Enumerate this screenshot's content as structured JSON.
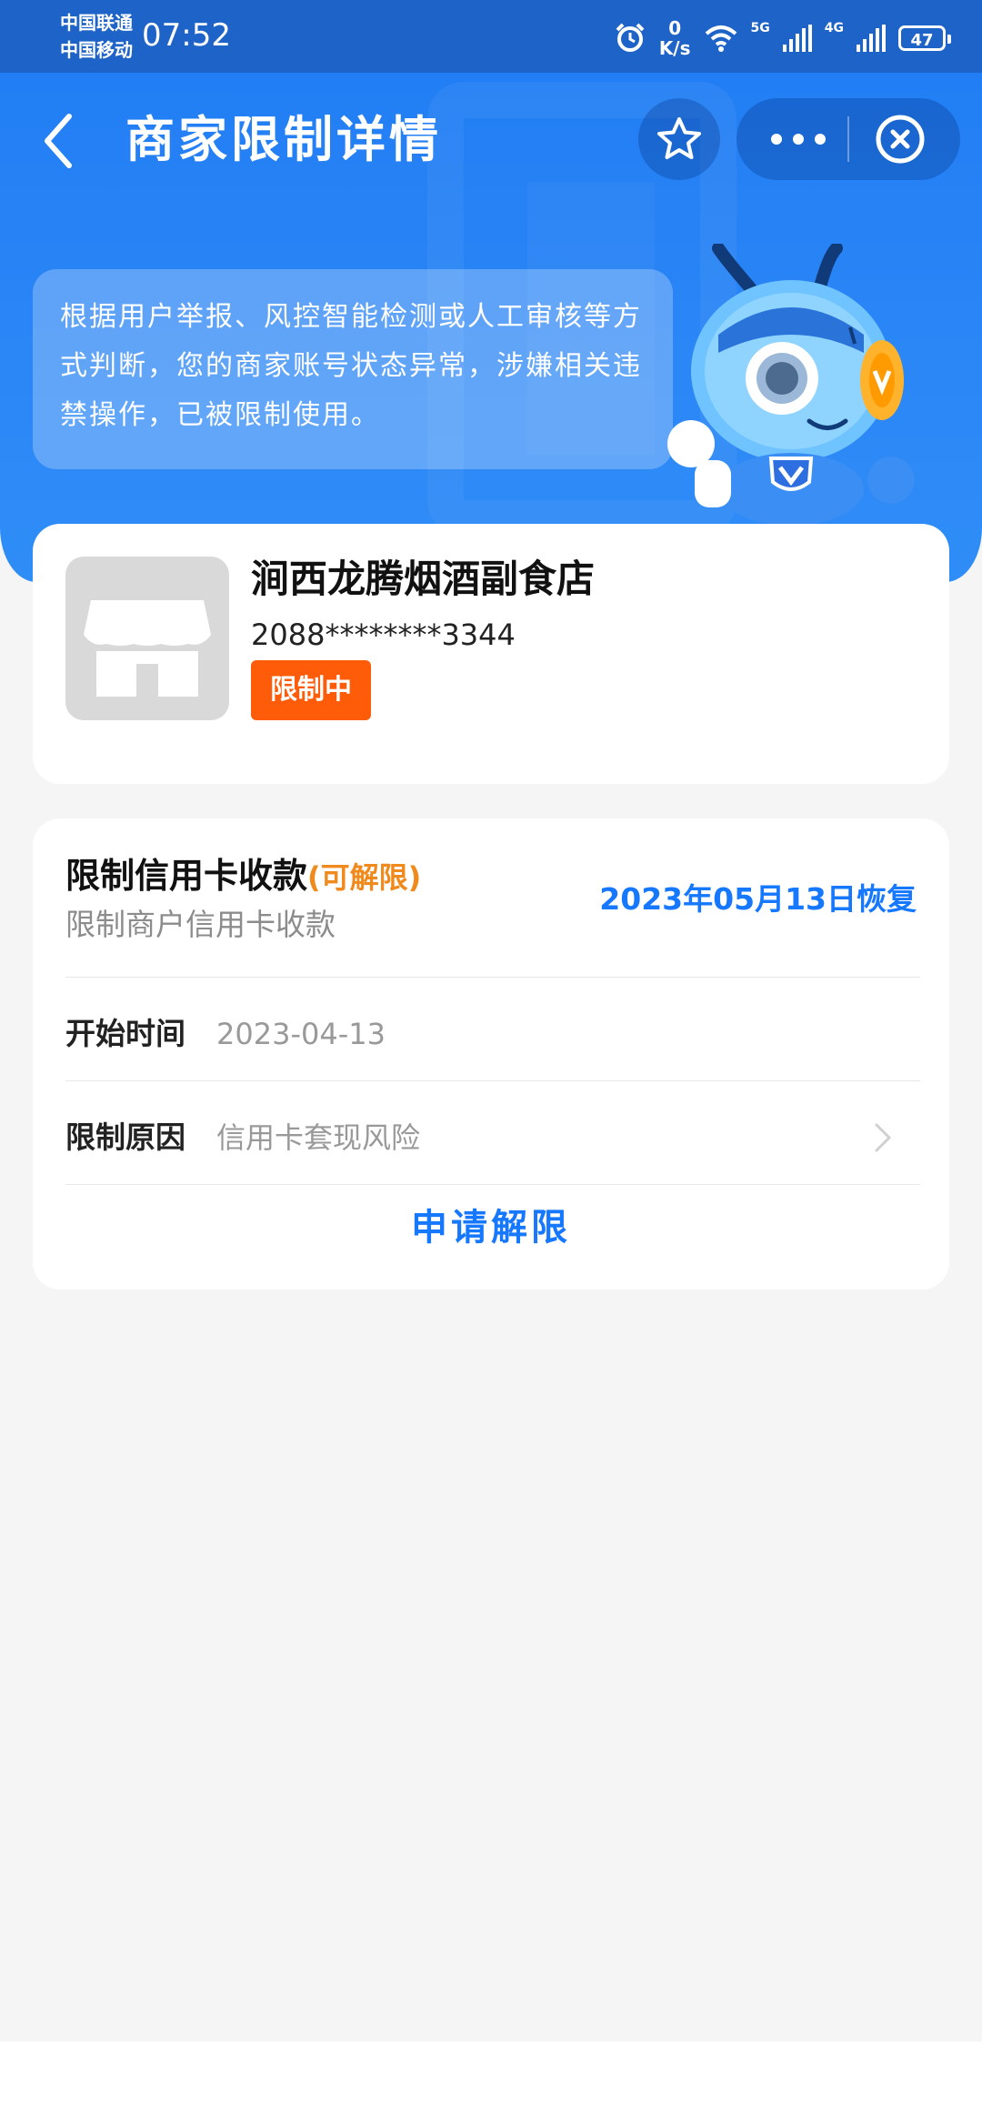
{
  "status_bar": {
    "carrier_1": "中国联通",
    "carrier_2": "中国移动",
    "time": "07:52",
    "net_speed_value": "0",
    "net_speed_unit": "K/s",
    "signal_1_label": "5G",
    "signal_2_label": "4G",
    "battery": "47"
  },
  "nav": {
    "title": "商家限制详情"
  },
  "notice": {
    "text": "根据用户举报、风控智能检测或人工审核等方式判断，您的商家账号状态异常，涉嫌相关违禁操作，已被限制使用。"
  },
  "merchant": {
    "name": "涧西龙腾烟酒副食店",
    "account_id": "2088********3344",
    "status": "限制中"
  },
  "restriction": {
    "title": "限制信用卡收款",
    "tag": "(可解限)",
    "subtitle": "限制商户信用卡收款",
    "recover_date": "2023年05月13日恢复",
    "start_label": "开始时间",
    "start_value": "2023-04-13",
    "reason_label": "限制原因",
    "reason_value": "信用卡套现风险",
    "apply_label": "申请解限"
  },
  "colors": {
    "header_blue": "#2b86f6",
    "status_bar": "#1e63c7",
    "link_blue": "#1677ff",
    "badge_orange": "#ff5c0a",
    "tag_orange": "#f08a1c"
  },
  "icons": {
    "back": "chevron-left-icon",
    "star": "star-icon",
    "more": "more-dots-icon",
    "close": "close-circle-icon",
    "store": "store-icon",
    "arrow": "chevron-right-icon"
  }
}
